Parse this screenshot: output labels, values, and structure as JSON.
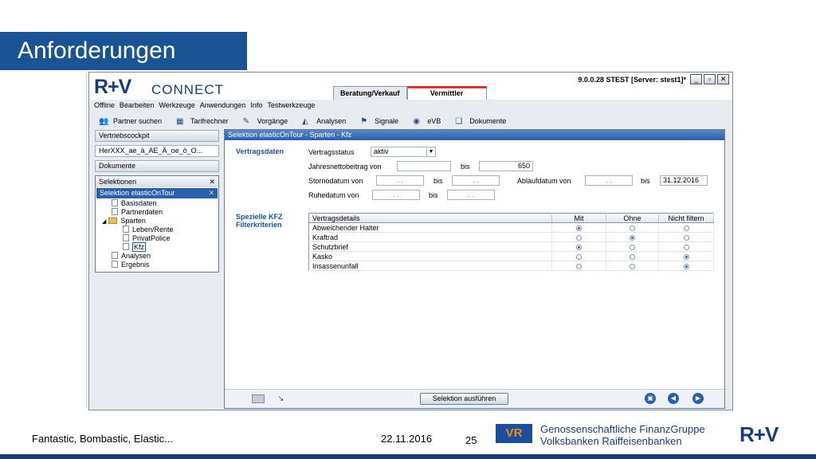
{
  "slide": {
    "title": "Anforderungen",
    "footer_left": "Fantastic, Bombastic, Elastic...",
    "footer_date": "22.11.2016",
    "page_number": "25",
    "org_line1": "Genossenschaftliche FinanzGruppe",
    "org_line2": "Volksbanken Raiffeisenbanken",
    "footer_logo": "R+V",
    "vr_logo": "VR"
  },
  "app": {
    "logo": "R+V",
    "logo_connect": "CONNECT",
    "version": "9.0.0.28 STEST [Server: stest1]*",
    "tabs": [
      "Beratung/Verkauf",
      "Vermittler"
    ],
    "menu": [
      "Offline",
      "Bearbeiten",
      "Werkzeuge",
      "Anwendungen",
      "Info",
      "Testwerkzeuge"
    ],
    "toolbar": [
      {
        "label": "Partner suchen",
        "icon": "people-icon"
      },
      {
        "label": "Tarifrechner",
        "icon": "calculator-icon"
      },
      {
        "label": "Vorgänge",
        "icon": "edit-icon"
      },
      {
        "label": "Analysen",
        "icon": "chart-icon"
      },
      {
        "label": "Signale",
        "icon": "signal-icon"
      },
      {
        "label": "eVB",
        "icon": "evb-icon"
      },
      {
        "label": "Dokumente",
        "icon": "documents-icon"
      }
    ]
  },
  "sidebar": {
    "cockpit": "Vertriebscockpit",
    "field": "HerXXX_ae_ä_AE_Ä_oe_ö_O...",
    "documents": "Dokumente",
    "panel_title": "Selektionen",
    "selected": "Selektion elasticOnTour",
    "tree": {
      "basisdaten": "Basisdaten",
      "partnerdaten": "Partnerdaten",
      "sparten": "Sparten",
      "leben": "Leben/Rente",
      "privat": "PrivatPolice",
      "kfz": "Kfz",
      "analysen": "Analysen",
      "ergebnis": "Ergebnis"
    }
  },
  "main": {
    "header": "Selektion elasticOnTour - Sparten - Kfz",
    "section1": "Vertragsdaten",
    "status_label": "Vertragsstatus",
    "status_value": "aktiv",
    "jnb_label": "Jahresnettobeitrag von",
    "jnb_from": "",
    "bis": "bis",
    "jnb_to": "650",
    "storno_label": "Stornodatum von",
    "date_placeholder": ". .",
    "ablauf_label": "Ablaufdatum von",
    "ablauf_to": "31.12.2016",
    "ruhe_label": "Ruhedatum von",
    "section2_line1": "Spezielle KFZ",
    "section2_line2": "Filterkriterien",
    "table": {
      "headers": [
        "Vertragsdetails",
        "Mit",
        "Ohne",
        "Nicht filtern"
      ],
      "rows": [
        {
          "label": "Abweichender Halter",
          "selected": 0
        },
        {
          "label": "Kraftrad",
          "selected": 1
        },
        {
          "label": "Schutzbrief",
          "selected": 0
        },
        {
          "label": "Kasko",
          "selected": 2
        },
        {
          "label": "Insassenunfall",
          "selected": 2
        }
      ]
    },
    "run_button": "Selektion ausführen"
  }
}
